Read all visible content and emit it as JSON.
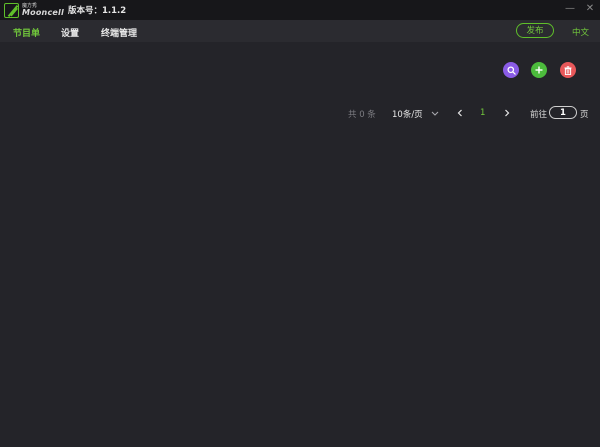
{
  "titlebar": {
    "logo_cn": "魔方秀",
    "logo_en": "Mooncell",
    "version": "版本号：1.1.2",
    "minimize_symbol": "—",
    "close_symbol": "✕"
  },
  "nav": {
    "items": [
      {
        "label": "节目单",
        "active": true
      },
      {
        "label": "设置",
        "active": false
      },
      {
        "label": "终端管理",
        "active": false
      }
    ],
    "publish_label": "发布",
    "language_label": "中文"
  },
  "actions": {
    "search_icon": "search-icon",
    "add_icon": "plus-icon",
    "delete_icon": "trash-icon"
  },
  "pagination": {
    "total_label": "共 0 条",
    "page_size_label": "10条/页",
    "current_page": "1",
    "goto_label": "前往",
    "goto_value": "1",
    "page_suffix": "页"
  },
  "colors": {
    "accent": "#72c83c",
    "search": "#8a5ce6",
    "add": "#4cbb3c",
    "delete": "#e8585a",
    "background": "#242429",
    "titlebar": "#17171a",
    "navbar": "#2b2b30"
  }
}
